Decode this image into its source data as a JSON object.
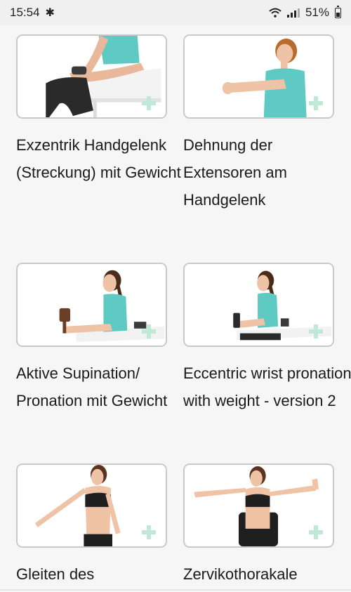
{
  "status_bar": {
    "time": "15:54",
    "battery": "51%",
    "icons": [
      "bluetooth-icon",
      "wifi-icon",
      "signal-icon",
      "battery-icon"
    ]
  },
  "exercises": [
    {
      "title": "Exzentrik Handgelenk (Streckung) mit Gewicht"
    },
    {
      "title": "Dehnung der Extensoren am Handgelenk"
    },
    {
      "title": "Aktive Supination/ Pronation mit Gewicht"
    },
    {
      "title": "Eccentric wrist pronation with weight - version 2"
    },
    {
      "title": "Gleiten des"
    },
    {
      "title": "Zervikothorakale"
    }
  ],
  "colors": {
    "background": "#f6f6f6",
    "card_border": "#c9c9c9",
    "plus_accent": "#bfe9d6",
    "shirt": "#5fcac3"
  }
}
